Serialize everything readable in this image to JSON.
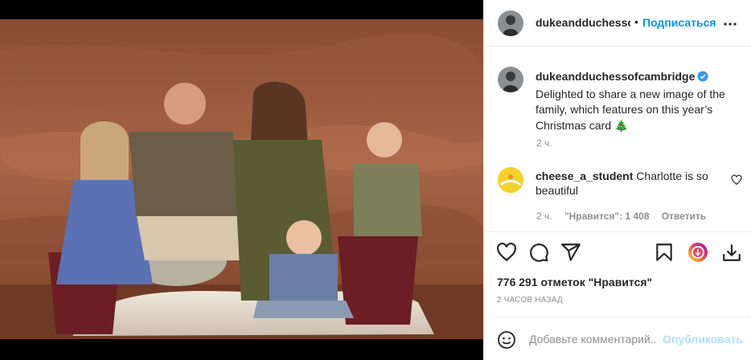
{
  "header": {
    "username": "dukeandduchessof",
    "separator": "•",
    "follow_label": "Подписаться"
  },
  "caption": {
    "username": "dukeandduchessofcambridge",
    "text": "Delighted to share a new image of the family, which features on this year’s Christmas card 🎄",
    "time": "2 ч."
  },
  "comment": {
    "username": "cheese_a_student",
    "text": "Charlotte is so beautiful",
    "time": "2 ч.",
    "likes": "\"Нравится\": 1 408",
    "reply_label": "Ответить"
  },
  "likes": "776 291 отметок \"Нравится\"",
  "date": "2 ЧАСОВ НАЗАД",
  "add_comment": {
    "placeholder": "Добавьте комментарий...",
    "post_label": "Опубликовать"
  },
  "colors": {
    "accent": "#0095f6",
    "verified": "#3897f0",
    "post_disabled": "#b2dffc",
    "secondary_text": "#8e8e8e"
  },
  "icons": [
    "more-icon",
    "verified-icon",
    "heart-icon",
    "comment-icon",
    "share-icon",
    "save-icon",
    "reels-icon",
    "download-icon",
    "emoji-icon"
  ]
}
